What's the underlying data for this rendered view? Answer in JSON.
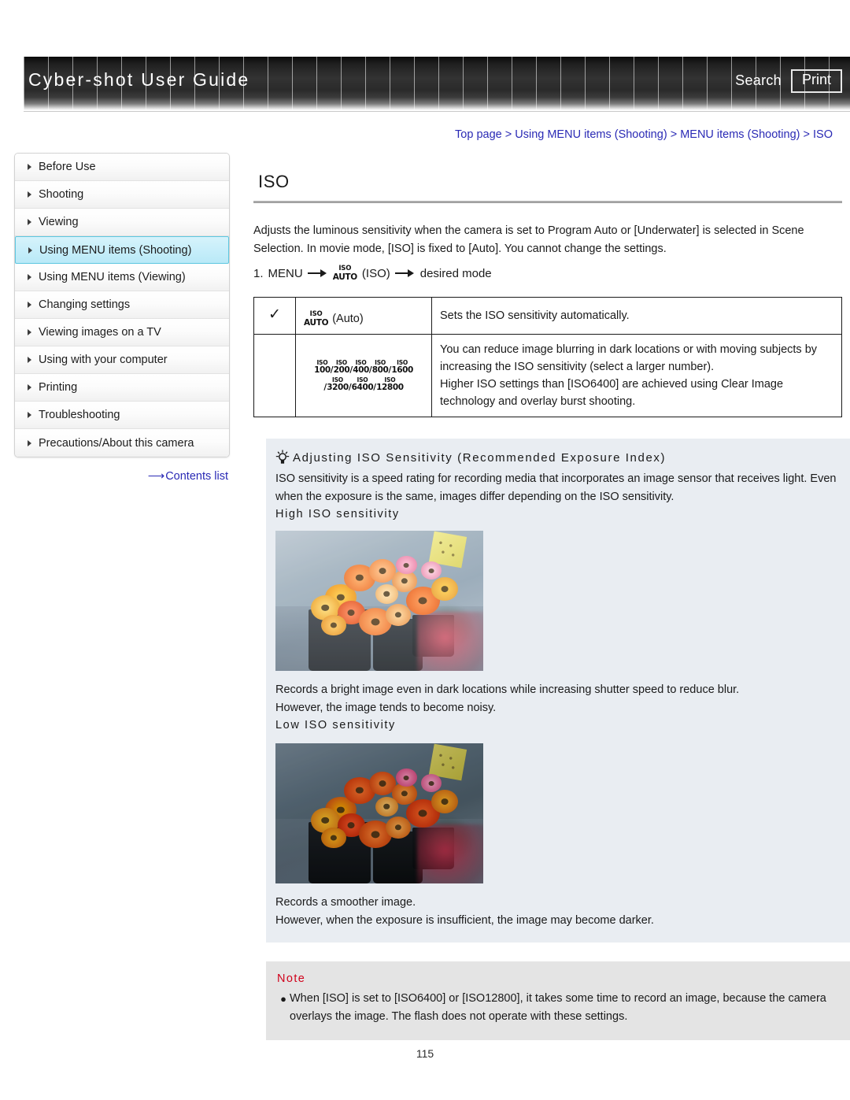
{
  "header": {
    "title": "Cyber-shot User Guide",
    "search_label": "Search",
    "print_label": "Print"
  },
  "breadcrumb": {
    "separator": ">",
    "items": [
      "Top page",
      "Using MENU items (Shooting)",
      "MENU items (Shooting)",
      "ISO"
    ]
  },
  "sidebar": {
    "items": [
      {
        "label": "Before Use",
        "active": false
      },
      {
        "label": "Shooting",
        "active": false
      },
      {
        "label": "Viewing",
        "active": false
      },
      {
        "label": "Using MENU items (Shooting)",
        "active": true
      },
      {
        "label": "Using MENU items (Viewing)",
        "active": false
      },
      {
        "label": "Changing settings",
        "active": false
      },
      {
        "label": "Viewing images on a TV",
        "active": false
      },
      {
        "label": "Using with your computer",
        "active": false
      },
      {
        "label": "Printing",
        "active": false
      },
      {
        "label": "Troubleshooting",
        "active": false
      },
      {
        "label": "Precautions/About this camera",
        "active": false
      }
    ],
    "contents_link": "Contents list"
  },
  "main": {
    "title": "ISO",
    "intro": "Adjusts the luminous sensitivity when the camera is set to Program Auto or [Underwater] is selected in Scene Selection. In movie mode, [ISO] is fixed to [Auto]. You cannot change the settings.",
    "step": {
      "number": "1.",
      "menu_label": "MENU",
      "icon_top": "ISO",
      "icon_bottom": "AUTO",
      "icon_caption": "(ISO)",
      "result": "desired mode"
    },
    "table": {
      "rows": [
        {
          "checked": true,
          "check_glyph": "✓",
          "icon_top": "ISO",
          "icon_bottom": "AUTO",
          "option_label": "(Auto)",
          "description": "Sets the ISO sensitivity automatically."
        },
        {
          "checked": false,
          "iso_values_line1": [
            "100",
            "200",
            "400",
            "800",
            "1600"
          ],
          "iso_values_line2": [
            "3200",
            "6400",
            "12800"
          ],
          "iso_prefix": "ISO",
          "description": "You can reduce image blurring in dark locations or with moving subjects by increasing the ISO sensitivity (select a larger number).\nHigher ISO settings than [ISO6400] are achieved using Clear Image technology and overlay burst shooting."
        }
      ]
    }
  },
  "tip": {
    "heading": "Adjusting ISO Sensitivity (Recommended Exposure Index)",
    "body": "ISO sensitivity is a speed rating for recording media that incorporates an image sensor that receives light. Even when the exposure is the same, images differ depending on the ISO sensitivity.",
    "high": {
      "label": "High ISO sensitivity",
      "caption": "Records a bright image even in dark locations while increasing shutter speed to reduce blur.\nHowever, the image tends to become noisy.",
      "image_alt": "orange and yellow gerbera flowers in buckets, brightly exposed"
    },
    "low": {
      "label": "Low ISO sensitivity",
      "caption": "Records a smoother image.\nHowever, when the exposure is insufficient, the image may become darker.",
      "image_alt": "orange and yellow gerbera flowers in buckets, darker exposure"
    }
  },
  "note": {
    "title": "Note",
    "bullet_glyph": "●",
    "items": [
      "When [ISO] is set to [ISO6400] or [ISO12800], it takes some time to record an image, because the camera overlays the image. The flash does not operate with these settings."
    ]
  },
  "footer": {
    "page_number": "115"
  },
  "colors": {
    "link": "#2a2ab5",
    "note_title": "#d0021b",
    "active_nav": "#c7eefa",
    "tip_panel_bg": "#e9edf2",
    "note_bg": "#e4e4e4"
  }
}
